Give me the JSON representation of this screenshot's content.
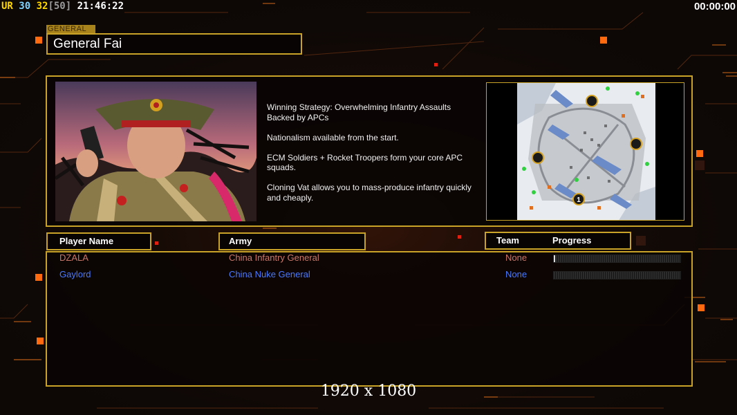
{
  "hud": {
    "prefix": "UR",
    "fps1": "30",
    "fps2": "32",
    "fps_cap": "[50]",
    "clock": "21:46:22",
    "timer": "00:00:00"
  },
  "general_tag": "GENERAL",
  "general_name": "General Fai",
  "strategy": [
    "Winning Strategy: Overwhelming Infantry Assaults\n Backed by APCs",
    "Nationalism available from the start.",
    "ECM Soldiers + Rocket Troopers form your core APC\n squads.",
    "Cloning Vat allows you to mass-produce infantry quickly\n and cheaply."
  ],
  "headers": {
    "player": "Player Name",
    "army": "Army",
    "team": "Team",
    "progress": "Progress"
  },
  "players": [
    {
      "name": "DZALA",
      "army": "China Infantry General",
      "team": "None",
      "progress": 0.01,
      "color": "#c9786a"
    },
    {
      "name": "Gaylord",
      "army": "China Nuke General",
      "team": "None",
      "progress": 0.0,
      "color": "#4a7aff"
    }
  ],
  "map": {
    "start_marker": "1"
  },
  "resolution": "1920 x 1080",
  "colors": {
    "accent": "#c9a327",
    "hud_ur": "#ffd800",
    "hud_30": "#7ed3ff",
    "hud_32": "#ffd800",
    "hud_cap": "#9a9a9a"
  }
}
